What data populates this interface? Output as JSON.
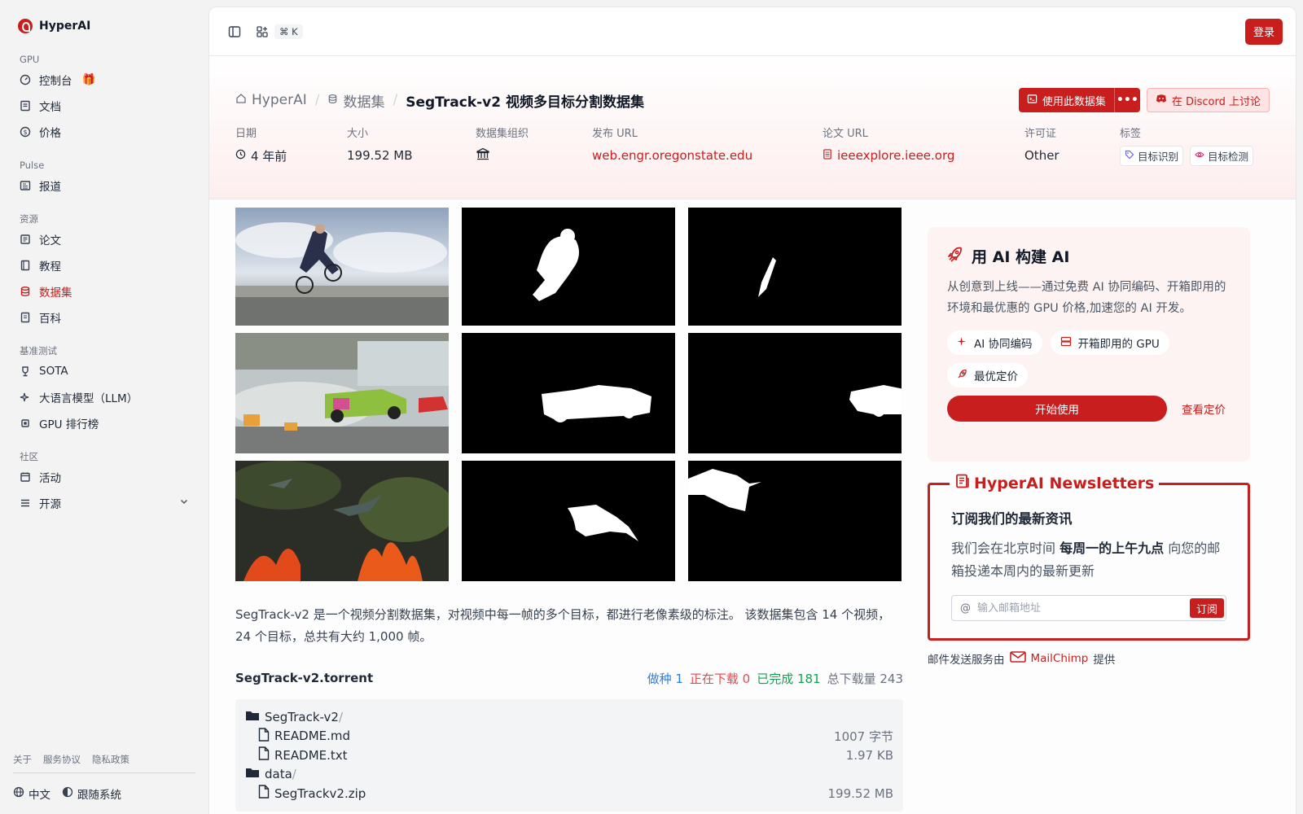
{
  "brand": {
    "name": "HyperAI"
  },
  "sidebar": {
    "sections": [
      {
        "title": "GPU",
        "items": [
          {
            "label": "控制台",
            "icon": "gauge-icon"
          },
          {
            "label": "文档",
            "icon": "doc-icon"
          },
          {
            "label": "价格",
            "icon": "dollar-icon"
          }
        ]
      },
      {
        "title": "Pulse",
        "items": [
          {
            "label": "报道",
            "icon": "newspaper-icon"
          }
        ]
      },
      {
        "title": "资源",
        "items": [
          {
            "label": "论文",
            "icon": "paper-icon"
          },
          {
            "label": "教程",
            "icon": "book-icon"
          },
          {
            "label": "数据集",
            "icon": "database-icon"
          },
          {
            "label": "百科",
            "icon": "encyclopedia-icon"
          }
        ]
      },
      {
        "title": "基准测试",
        "items": [
          {
            "label": "SOTA",
            "icon": "trophy-icon"
          },
          {
            "label": "大语言模型（LLM）",
            "icon": "sparkles-icon"
          },
          {
            "label": "GPU 排行榜",
            "icon": "chip-icon"
          }
        ]
      },
      {
        "title": "社区",
        "items": [
          {
            "label": "活动",
            "icon": "calendar-icon"
          },
          {
            "label": "开源",
            "icon": "list-icon"
          }
        ]
      }
    ],
    "active": "数据集",
    "footer_links": [
      "关于",
      "服务协议",
      "隐私政策"
    ],
    "language": "中文",
    "theme": "跟随系统"
  },
  "topbar": {
    "shortcut": "⌘ K",
    "login": "登录"
  },
  "breadcrumb": {
    "home": "HyperAI",
    "section": "数据集",
    "current": "SegTrack-v2 视频多目标分割数据集"
  },
  "actions": {
    "use": "使用此数据集",
    "more": "•••",
    "discord": "在 Discord 上讨论"
  },
  "meta": {
    "date_label": "日期",
    "date_value": "4 年前",
    "size_label": "大小",
    "size_value": "199.52 MB",
    "org_label": "数据集组织",
    "publish_label": "发布 URL",
    "publish_value": "web.engr.oregonstate.edu",
    "paper_label": "论文 URL",
    "paper_value": "ieeexplore.ieee.org",
    "license_label": "许可证",
    "license_value": "Other",
    "tags_label": "标签",
    "tags": [
      "目标识别",
      "目标检测"
    ]
  },
  "description": "SegTrack-v2 是一个视频分割数据集，对视频中每一帧的多个目标，都进行老像素级的标注。 该数据集包含 14 个视频，24 个目标，总共有大约 1,000 帧。",
  "torrent": {
    "name": "SegTrack-v2.torrent",
    "seeding": "做种 1",
    "downloading": "正在下载 0",
    "completed": "已完成 181",
    "total": "总下载量 243",
    "files": [
      {
        "name": "SegTrack-v2",
        "type": "folder",
        "size": ""
      },
      {
        "name": "README.md",
        "type": "file",
        "size": "1007 字节"
      },
      {
        "name": "README.txt",
        "type": "file",
        "size": "1.97 KB"
      },
      {
        "name": "data",
        "type": "folder",
        "size": ""
      },
      {
        "name": "SegTrackv2.zip",
        "type": "file",
        "size": "199.52 MB"
      }
    ]
  },
  "ai_card": {
    "title": "用 AI 构建 AI",
    "desc": "从创意到上线——通过免费 AI 协同编码、开箱即用的环境和最优惠的 GPU 价格,加速您的 AI 开发。",
    "chips": [
      "AI 协同编码",
      "开箱即用的 GPU",
      "最优定价"
    ],
    "start": "开始使用",
    "pricing": "查看定价"
  },
  "newsletter": {
    "legend": "HyperAI Newsletters",
    "sub": "订阅我们的最新资讯",
    "text_before": "我们会在北京时间 ",
    "text_bold": "每周一的上午九点",
    "text_after": " 向您的邮箱投递本周内的最新更新",
    "placeholder": "输入邮箱地址",
    "subscribe": "订阅",
    "note_before": "邮件发送服务由",
    "provider": "MailChimp",
    "note_after": "提供"
  },
  "colors": {
    "accent": "#c81e1e",
    "seeding": "#2b7de9",
    "downloading": "#e5484d",
    "completed": "#12a150",
    "total": "#6b7280"
  }
}
